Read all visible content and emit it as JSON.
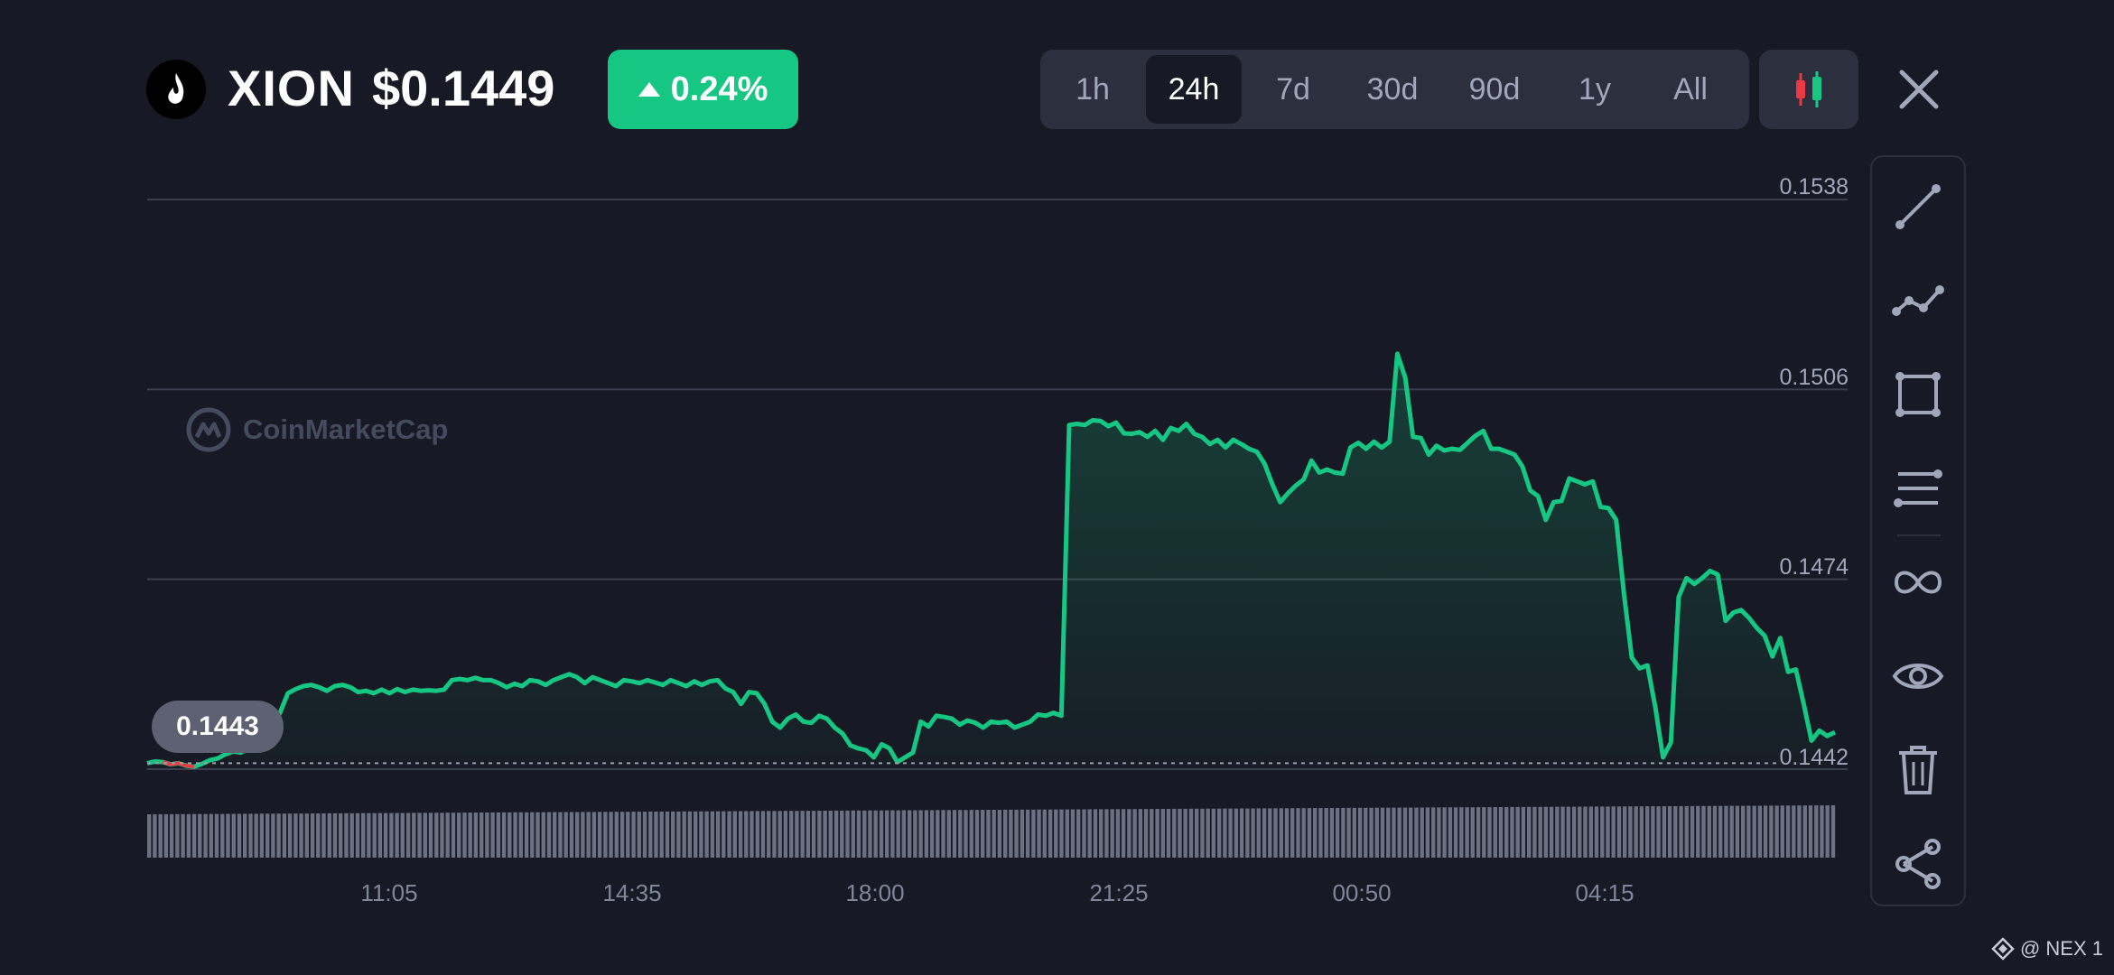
{
  "header": {
    "ticker": "XION",
    "price": "$0.1449",
    "change": "0.24%",
    "ranges": [
      "1h",
      "24h",
      "7d",
      "30d",
      "90d",
      "1y",
      "All"
    ],
    "active_range": "24h"
  },
  "watermark": "CoinMarketCap",
  "current_price_label": "0.1443",
  "footer": "@ NEX 1",
  "colors": {
    "up": "#16c784",
    "down": "#ea3943",
    "background": "#171a24",
    "panel": "#2b2f3e"
  },
  "toolbar_icons": [
    "trend-line-icon",
    "polyline-icon",
    "rectangle-icon",
    "parallel-lines-icon",
    "infinity-icon",
    "eye-icon",
    "trash-icon",
    "share-icon"
  ],
  "chart_data": {
    "type": "line",
    "ylabels": [
      "0.1538",
      "0.1506",
      "0.1474",
      "0.1442"
    ],
    "xlabels": [
      "11:05",
      "14:35",
      "18:00",
      "21:25",
      "00:50",
      "04:15"
    ],
    "ylim": [
      0.1442,
      0.1538
    ],
    "y": [
      0.1443,
      0.14433,
      0.14432,
      0.14428,
      0.1443,
      0.14426,
      0.14424,
      0.14429,
      0.14435,
      0.14438,
      0.14445,
      0.1445,
      0.14448,
      0.14455,
      0.14462,
      0.1447,
      0.14495,
      0.14515,
      0.14548,
      0.14555,
      0.1456,
      0.14562,
      0.14558,
      0.14552,
      0.1456,
      0.14562,
      0.14558,
      0.1455,
      0.14552,
      0.14548,
      0.14554,
      0.14548,
      0.14555,
      0.1455,
      0.14554,
      0.14552,
      0.14553,
      0.14552,
      0.14554,
      0.1457,
      0.14572,
      0.1457,
      0.14574,
      0.1457,
      0.1457,
      0.14565,
      0.14558,
      0.14564,
      0.1456,
      0.1457,
      0.14568,
      0.14562,
      0.1457,
      0.14575,
      0.1458,
      0.14575,
      0.14565,
      0.14575,
      0.1457,
      0.14565,
      0.1456,
      0.1457,
      0.14568,
      0.14565,
      0.1457,
      0.14566,
      0.14562,
      0.1457,
      0.14565,
      0.1456,
      0.14568,
      0.14562,
      0.14568,
      0.1457,
      0.14556,
      0.1455,
      0.1453,
      0.1455,
      0.14548,
      0.1453,
      0.145,
      0.1449,
      0.14505,
      0.14512,
      0.145,
      0.14498,
      0.1451,
      0.14505,
      0.1449,
      0.1448,
      0.1446,
      0.14455,
      0.14452,
      0.1444,
      0.14462,
      0.14455,
      0.14432,
      0.1444,
      0.14448,
      0.145,
      0.14492,
      0.1451,
      0.14508,
      0.14505,
      0.14495,
      0.14502,
      0.14498,
      0.1449,
      0.145,
      0.14498,
      0.145,
      0.1449,
      0.14495,
      0.145,
      0.14512,
      0.1451,
      0.14515,
      0.1451,
      0.15,
      0.15002,
      0.15,
      0.15008,
      0.15007,
      0.14998,
      0.15004,
      0.14986,
      0.14985,
      0.14988,
      0.1498,
      0.1499,
      0.14975,
      0.14995,
      0.1499,
      0.15002,
      0.14985,
      0.1498,
      0.14968,
      0.14975,
      0.14962,
      0.14975,
      0.14968,
      0.1496,
      0.14955,
      0.14935,
      0.149,
      0.1487,
      0.14885,
      0.14898,
      0.14908,
      0.1494,
      0.1492,
      0.14925,
      0.1492,
      0.14918,
      0.14962,
      0.1497,
      0.1496,
      0.14972,
      0.14962,
      0.14972,
      0.1512,
      0.1508,
      0.1498,
      0.14978,
      0.1495,
      0.14965,
      0.14957,
      0.1496,
      0.14958,
      0.1497,
      0.14982,
      0.1499,
      0.1496,
      0.1496,
      0.14955,
      0.1495,
      0.1493,
      0.1489,
      0.1488,
      0.1484,
      0.1487,
      0.14872,
      0.1491,
      0.14905,
      0.149,
      0.14905,
      0.14862,
      0.1486,
      0.1484,
      0.14715,
      0.14608,
      0.1459,
      0.14595,
      0.14525,
      0.1444,
      0.14465,
      0.1471,
      0.14742,
      0.14732,
      0.14742,
      0.14754,
      0.14748,
      0.1467,
      0.14684,
      0.14688,
      0.14675,
      0.14658,
      0.14645,
      0.1461,
      0.14641,
      0.14584,
      0.14588,
      0.1453,
      0.14468,
      0.14485,
      0.14476,
      0.14482
    ]
  }
}
